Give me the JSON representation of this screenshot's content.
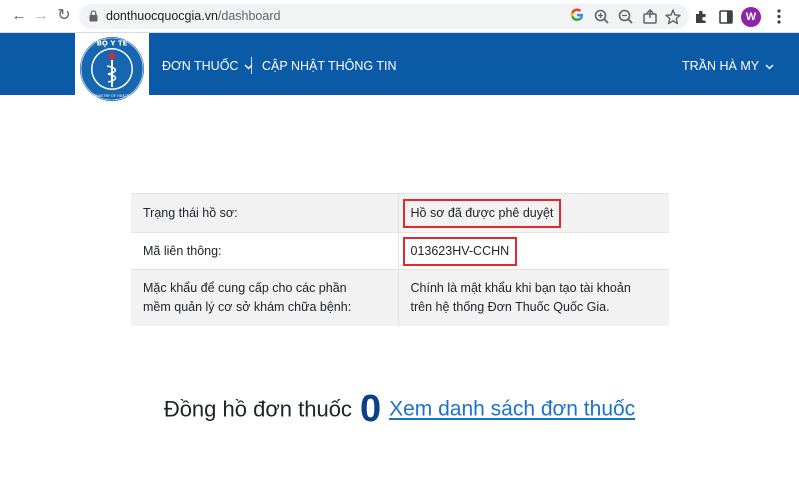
{
  "browser": {
    "url_domain": "donthuocquocgia.vn",
    "url_path": "/dashboard",
    "profile_initial": "W"
  },
  "header": {
    "logo_top_text": "BỘ Y TẾ",
    "logo_bottom_text": "MINISTRY OF HEALTH",
    "nav_prescription": "ĐƠN THUỐC",
    "nav_update": "CẬP NHẬT THÔNG TIN",
    "user_name": "TRẦN HÀ MY"
  },
  "info_table": {
    "rows": [
      {
        "label": "Trạng thái hồ sơ:",
        "value": "Hồ sơ đã được phê duyệt"
      },
      {
        "label": "Mã liên thông:",
        "value": "013623HV-CCHN"
      },
      {
        "label": "Mặc khẩu để cung cấp cho các phần mềm quản lý cơ sở khám chữa bệnh:",
        "value": "Chính là mật khẩu khi bạn tạo tài khoản trên hệ thống Đơn Thuốc Quốc Gia."
      }
    ]
  },
  "counter": {
    "label": "Đồng hồ đơn thuốc",
    "value": "0",
    "link": "Xem danh sách đơn thuốc"
  },
  "colors": {
    "header_blue": "#0a5aa6",
    "highlight_red": "#e0282e",
    "link_blue": "#1a73c8",
    "counter_blue": "#0a3f8a"
  }
}
